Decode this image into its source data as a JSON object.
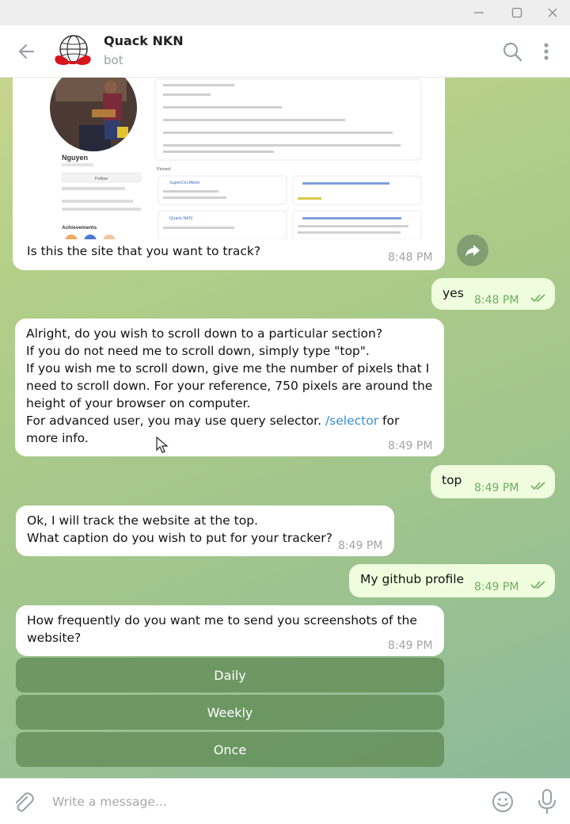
{
  "chat": {
    "title": "Quack NKN",
    "subtitle": "bot"
  },
  "preview": {
    "profile_name": "Nguyen",
    "section_label": "Pinned",
    "achievements_label": "Achievements",
    "follow_label": "Follow",
    "repo_1": "SuperCircMeter",
    "repo_2": "Quack NKN",
    "caption": "Is this the site that you want to track?",
    "time": "8:48 PM"
  },
  "messages": [
    {
      "id": "m1",
      "side": "out",
      "text": "yes",
      "time": "8:48 PM"
    },
    {
      "id": "m2",
      "side": "in",
      "text_before": "Alright, do you wish to scroll down to a particular section?\nIf you do not need me to scroll down, simply type \"top\".\nIf you wish me to scroll down, give me the number of pixels that I need to scroll down. For your reference, 750 pixels are around the height of your browser on computer.\nFor advanced user, you may use query selector. ",
      "link": "/selector",
      "text_after": " for more info.",
      "time": "8:49 PM"
    },
    {
      "id": "m3",
      "side": "out",
      "text": "top",
      "time": "8:49 PM"
    },
    {
      "id": "m4",
      "side": "in",
      "text": "Ok, I will track the website at the top.\nWhat caption do you wish to put for your tracker?",
      "time": "8:49 PM"
    },
    {
      "id": "m5",
      "side": "out",
      "text": "My github profile",
      "time": "8:49 PM"
    },
    {
      "id": "m6",
      "side": "in",
      "text": "How frequently do you want me to send you screenshots of the website?",
      "time": "8:49 PM"
    }
  ],
  "keyboard": [
    "Daily",
    "Weekly",
    "Once"
  ],
  "input": {
    "placeholder": "Write a message..."
  },
  "icons": {
    "back": "arrow-left-icon",
    "search": "search-icon",
    "more": "more-vertical-icon",
    "attach": "paperclip-icon",
    "emoji": "emoji-icon",
    "mic": "microphone-icon",
    "forward": "forward-icon",
    "read": "double-check-icon"
  },
  "colors": {
    "incoming": "#ffffff",
    "outgoing": "#effdde",
    "link": "#3a8fd0",
    "keyboard_button": "#608c56",
    "check": "#6cae5a"
  }
}
